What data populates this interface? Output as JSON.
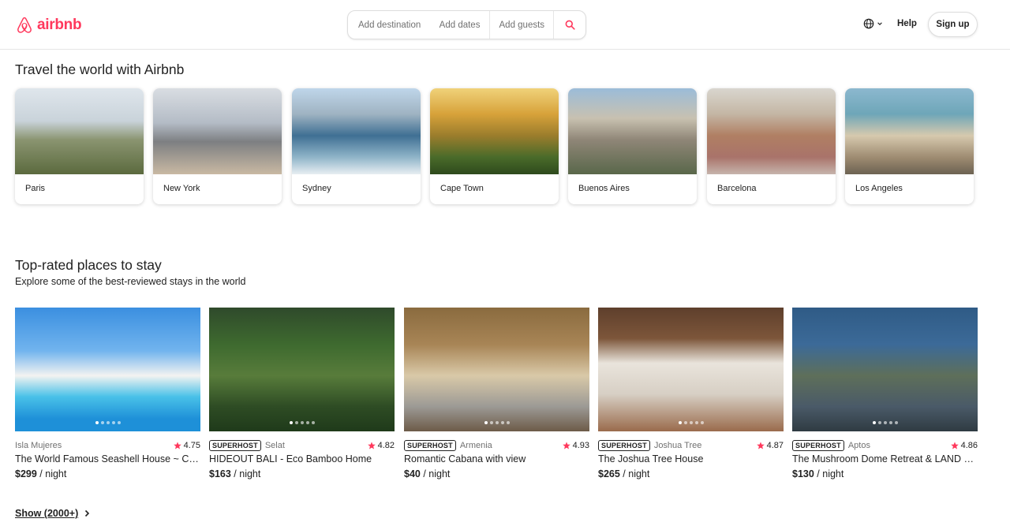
{
  "brand": {
    "name": "airbnb",
    "color": "#FF385C"
  },
  "search": {
    "destination": "Add destination",
    "dates": "Add dates",
    "guests": "Add guests",
    "icon": "search-icon"
  },
  "nav": {
    "language_icon": "globe-icon",
    "help": "Help",
    "signup": "Sign up"
  },
  "travel": {
    "title": "Travel the world with Airbnb",
    "cities": [
      {
        "name": "Paris"
      },
      {
        "name": "New York"
      },
      {
        "name": "Sydney"
      },
      {
        "name": "Cape Town"
      },
      {
        "name": "Buenos Aires"
      },
      {
        "name": "Barcelona"
      },
      {
        "name": "Los Angeles"
      }
    ]
  },
  "stays": {
    "title": "Top-rated places to stay",
    "subtitle": "Explore some of the best-reviewed stays in the world",
    "superhost_label": "SUPERHOST",
    "per_night": "/ night",
    "star_color": "#FF385C",
    "items": [
      {
        "location": "Isla Mujeres",
        "superhost": false,
        "rating": "4.75",
        "title": "The World Famous Seashell House ~ Casa Caracol",
        "price": "$299"
      },
      {
        "location": "Selat",
        "superhost": true,
        "rating": "4.82",
        "title": "HIDEOUT BALI - Eco Bamboo Home",
        "price": "$163"
      },
      {
        "location": "Armenia",
        "superhost": true,
        "rating": "4.93",
        "title": "Romantic Cabana with view",
        "price": "$40"
      },
      {
        "location": "Joshua Tree",
        "superhost": true,
        "rating": "4.87",
        "title": "The Joshua Tree House",
        "price": "$265"
      },
      {
        "location": "Aptos",
        "superhost": true,
        "rating": "4.86",
        "title": "The Mushroom Dome Retreat & LAND of Paradise",
        "price": "$130"
      }
    ],
    "show_more": "Show (2000+)"
  }
}
